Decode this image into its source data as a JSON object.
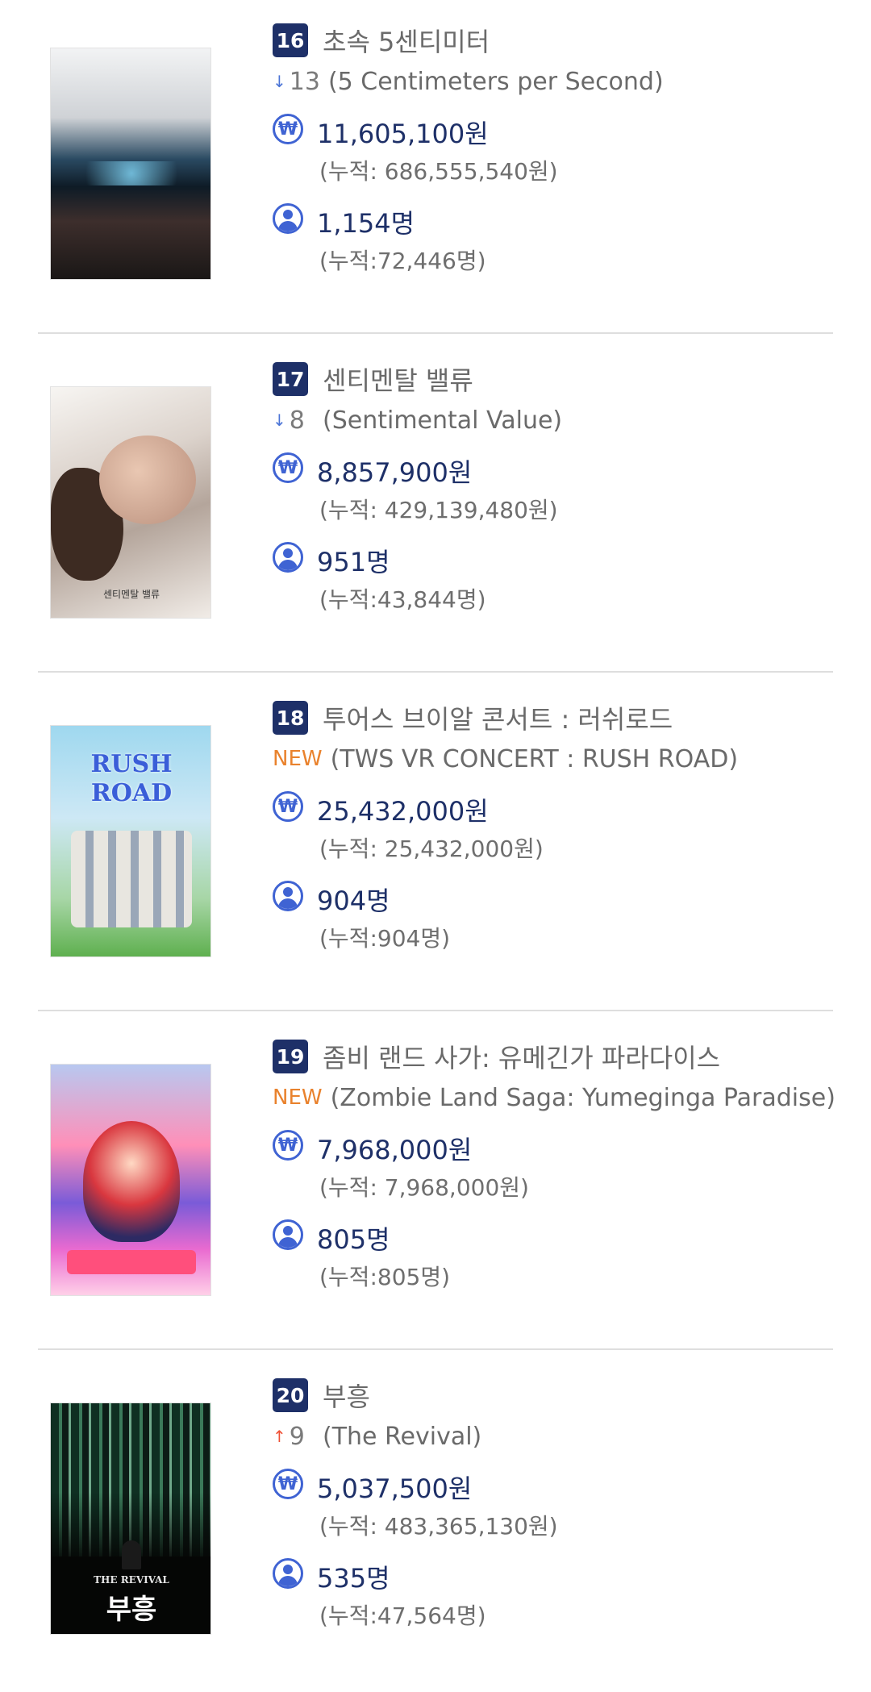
{
  "movies": [
    {
      "rank": "16",
      "title_ko": "초속 5센티미터",
      "change": {
        "type": "down",
        "value": "13"
      },
      "title_en": "(5 Centimeters per Second)",
      "sales": "11,605,100원",
      "sales_cumulative": "(누적: 686,555,540원)",
      "audience": "1,154명",
      "audience_cumulative": "(누적:72,446명)"
    },
    {
      "rank": "17",
      "title_ko": "센티멘탈 밸류",
      "change": {
        "type": "down",
        "value": "8"
      },
      "title_en": "(Sentimental Value)",
      "poster_text": "센티멘탈 밸류",
      "sales": "8,857,900원",
      "sales_cumulative": "(누적: 429,139,480원)",
      "audience": "951명",
      "audience_cumulative": "(누적:43,844명)"
    },
    {
      "rank": "18",
      "title_ko": "투어스 브이알 콘서트 : 러쉬로드",
      "change": {
        "type": "new",
        "value": "NEW"
      },
      "title_en": "(TWS VR CONCERT : RUSH ROAD)",
      "poster_text": "RUSH ROAD",
      "sales": "25,432,000원",
      "sales_cumulative": "(누적: 25,432,000원)",
      "audience": "904명",
      "audience_cumulative": "(누적:904명)"
    },
    {
      "rank": "19",
      "title_ko": "좀비 랜드 사가: 유메긴가 파라다이스",
      "change": {
        "type": "new",
        "value": "NEW"
      },
      "title_en": "(Zombie Land Saga: Yumeginga Paradise)",
      "sales": "7,968,000원",
      "sales_cumulative": "(누적: 7,968,000원)",
      "audience": "805명",
      "audience_cumulative": "(누적:805명)"
    },
    {
      "rank": "20",
      "title_ko": "부흥",
      "change": {
        "type": "up",
        "value": "9"
      },
      "title_en": "(The Revival)",
      "poster_text_en": "THE REVIVAL",
      "poster_text_ko": "부흥",
      "sales": "5,037,500원",
      "sales_cumulative": "(누적: 483,365,130원)",
      "audience": "535명",
      "audience_cumulative": "(누적:47,564명)"
    }
  ],
  "icons": {
    "down_arrow": "↓",
    "up_arrow": "↑",
    "won_symbol": "₩"
  },
  "colors": {
    "rank_badge": "#1e3068",
    "value_text": "#1e3068",
    "icon_blue": "#3f63d3",
    "new_orange": "#e9822d",
    "down_blue": "#4b74d6",
    "up_red": "#ef5035"
  }
}
